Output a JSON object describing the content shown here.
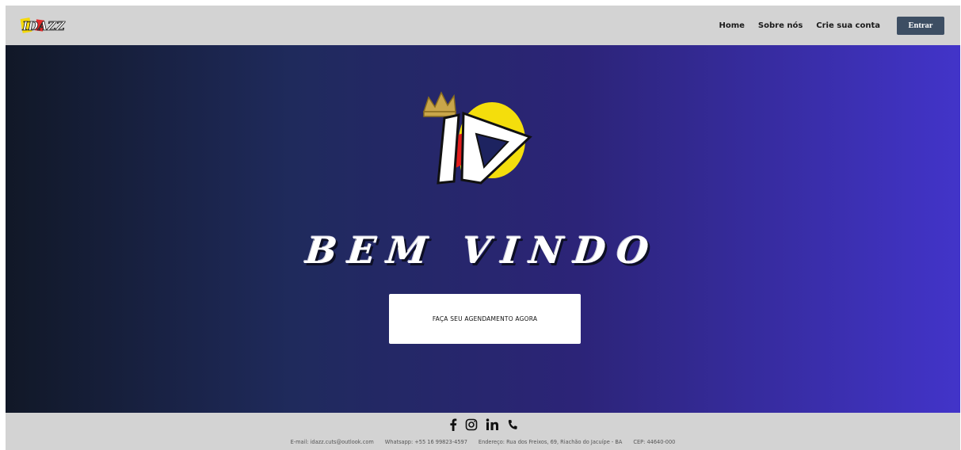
{
  "header": {
    "logo_text": "IDAZZ",
    "nav": [
      {
        "label": "Home"
      },
      {
        "label": "Sobre nós"
      },
      {
        "label": "Crie sua conta"
      }
    ],
    "login_label": "Entrar"
  },
  "hero": {
    "logo_text": "LD",
    "title": "BEM VINDO",
    "cta_label": "FAÇA SEU AGENDAMENTO AGORA"
  },
  "footer": {
    "social": [
      {
        "icon": "facebook-icon"
      },
      {
        "icon": "instagram-icon"
      },
      {
        "icon": "linkedin-icon"
      },
      {
        "icon": "phone-icon"
      }
    ],
    "contacts": {
      "email": "E-mail: idazz.cuts@outlook.com",
      "whatsapp": "Whatsapp: +55 16 99823-4597",
      "address": "Endereço: Rua dos Freixos, 69, Riachão do Jacuípe - BA",
      "cep": "CEP: 44640-000"
    }
  },
  "colors": {
    "header_bg": "#d3d3d3",
    "login_bg": "#3d4e63",
    "gradient_start": "#111827",
    "gradient_end": "#4234c9"
  }
}
